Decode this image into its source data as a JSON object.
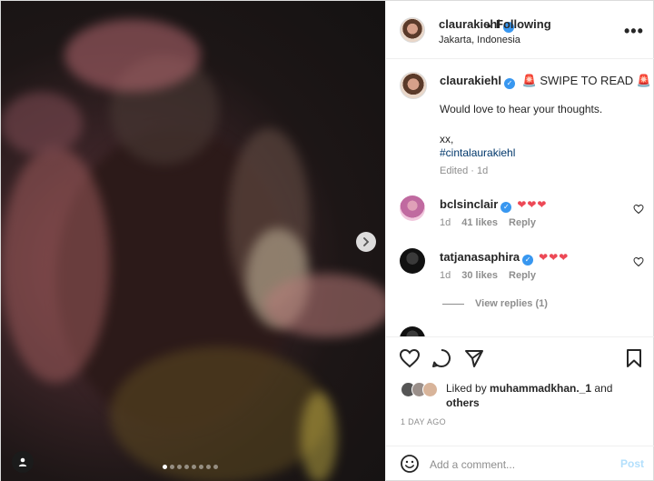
{
  "post": {
    "author": "claurakiehl",
    "separator": "•",
    "follow_status": "Following",
    "location": "Jakarta, Indonesia",
    "more_label": "•••"
  },
  "carousel": {
    "slide_count": 8,
    "active_index": 0,
    "next_icon": "chevron-right-icon",
    "tag_icon": "user-tag-icon"
  },
  "caption": {
    "author": "claurakiehl",
    "text": "🚨 SWIPE TO READ 🚨",
    "line2": "Would love to hear your thoughts.",
    "line3": "xx,",
    "hashtag": "#cintalaurakiehl",
    "meta": "Edited · 1d"
  },
  "comments": [
    {
      "user": "bclsinclair",
      "text": "❤❤❤",
      "age": "1d",
      "likes": "41 likes",
      "reply": "Reply"
    },
    {
      "user": "tatjanasaphira",
      "text": "❤❤❤",
      "age": "1d",
      "likes": "30 likes",
      "reply": "Reply"
    }
  ],
  "view_replies": "View replies (1)",
  "likes": {
    "prefix": "Liked by ",
    "user": "muhammadkhan._1",
    "middle": " and",
    "others": "others"
  },
  "time_ago": "1 DAY AGO",
  "add_comment": {
    "placeholder": "Add a comment...",
    "post_label": "Post"
  },
  "colors": {
    "verified": "#3897f0",
    "heart": "#ed4956",
    "link": "#00376b",
    "post_disabled": "#b2dffc"
  }
}
